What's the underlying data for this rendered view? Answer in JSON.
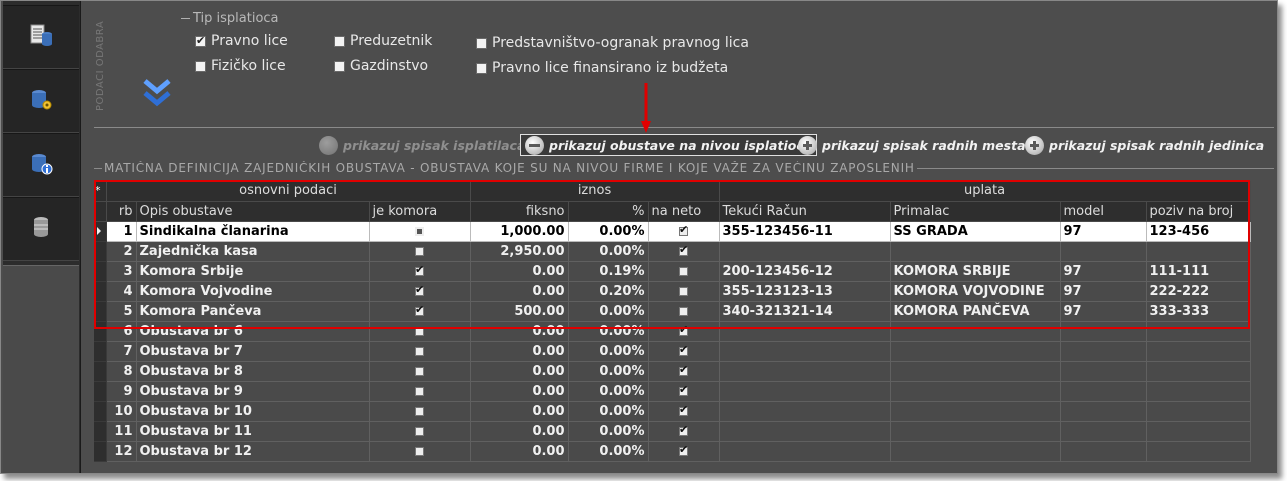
{
  "sidebar": {
    "buttons": [
      {
        "icon": "database-list-icon"
      },
      {
        "icon": "database-settings-icon"
      },
      {
        "icon": "database-info-icon"
      },
      {
        "icon": "database-icon"
      }
    ]
  },
  "filter": {
    "panel_label": "PODACI ODABRA",
    "legend": "Tip isplatioca",
    "options": [
      {
        "label": "Pravno lice",
        "checked": true
      },
      {
        "label": "Fizičko lice",
        "checked": false
      },
      {
        "label": "Preduzetnik",
        "checked": false
      },
      {
        "label": "Gazdinstvo",
        "checked": false
      },
      {
        "label": "Predstavništvo-ogranak pravnog lica",
        "checked": false
      },
      {
        "label": "Pravno lice finansirano iz budžeta",
        "checked": false
      }
    ]
  },
  "actions": {
    "isplatilaca": "prikazuj spisak isplatilaca",
    "obustave": "prikazuj obustave na nivou isplatioca",
    "radna_mesta": "prikazuj spisak radnih mesta",
    "radne_jedinice": "prikazuj spisak radnih jedinica"
  },
  "section_title": "MATIČNA DEFINICIJA ZAJEDNIČKIH OBUSTAVA - OBUSTAVA KOJE SU NA NIVOU FIRME I KOJE VAŽE ZA VEĆINU ZAPOSLENIH",
  "grid": {
    "new_row_marker": "*",
    "groups": {
      "osnovni": "osnovni podaci",
      "iznos": "iznos",
      "uplata": "uplata"
    },
    "columns": {
      "rb": "rb",
      "opis": "Opis obustave",
      "komora": "je komora",
      "fiksno": "fiksno",
      "procenat": "%",
      "neto": "na neto",
      "racun": "Tekući Račun",
      "primalac": "Primalac",
      "model": "model",
      "poziv": "poziv na broj"
    },
    "rows": [
      {
        "rb": "1",
        "opis": "Sindikalna članarina",
        "komora": "indeterminate",
        "fiksno": "1,000.00",
        "procenat": "0.00%",
        "neto": true,
        "racun": "355-123456-11",
        "primalac": "SS GRADA",
        "model": "97",
        "poziv": "123-456",
        "selected": true
      },
      {
        "rb": "2",
        "opis": "Zajednička kasa",
        "komora": false,
        "fiksno": "2,950.00",
        "procenat": "0.00%",
        "neto": true,
        "racun": "",
        "primalac": "",
        "model": "",
        "poziv": ""
      },
      {
        "rb": "3",
        "opis": "Komora Srbije",
        "komora": true,
        "fiksno": "0.00",
        "procenat": "0.19%",
        "neto": false,
        "racun": "200-123456-12",
        "primalac": "KOMORA SRBIJE",
        "model": "97",
        "poziv": "111-111"
      },
      {
        "rb": "4",
        "opis": "Komora Vojvodine",
        "komora": true,
        "fiksno": "0.00",
        "procenat": "0.20%",
        "neto": false,
        "racun": "355-123123-13",
        "primalac": "KOMORA VOJVODINE",
        "model": "97",
        "poziv": "222-222"
      },
      {
        "rb": "5",
        "opis": "Komora Pančeva",
        "komora": true,
        "fiksno": "500.00",
        "procenat": "0.00%",
        "neto": false,
        "racun": "340-321321-14",
        "primalac": "KOMORA PANČEVA",
        "model": "97",
        "poziv": "333-333"
      },
      {
        "rb": "6",
        "opis": "Obustava br 6",
        "komora": false,
        "fiksno": "0.00",
        "procenat": "0.00%",
        "neto": true,
        "racun": "",
        "primalac": "",
        "model": "",
        "poziv": ""
      },
      {
        "rb": "7",
        "opis": "Obustava br 7",
        "komora": false,
        "fiksno": "0.00",
        "procenat": "0.00%",
        "neto": true,
        "racun": "",
        "primalac": "",
        "model": "",
        "poziv": ""
      },
      {
        "rb": "8",
        "opis": "Obustava br 8",
        "komora": false,
        "fiksno": "0.00",
        "procenat": "0.00%",
        "neto": true,
        "racun": "",
        "primalac": "",
        "model": "",
        "poziv": ""
      },
      {
        "rb": "9",
        "opis": "Obustava br 9",
        "komora": false,
        "fiksno": "0.00",
        "procenat": "0.00%",
        "neto": true,
        "racun": "",
        "primalac": "",
        "model": "",
        "poziv": ""
      },
      {
        "rb": "10",
        "opis": "Obustava br 10",
        "komora": false,
        "fiksno": "0.00",
        "procenat": "0.00%",
        "neto": true,
        "racun": "",
        "primalac": "",
        "model": "",
        "poziv": ""
      },
      {
        "rb": "11",
        "opis": "Obustava br 11",
        "komora": false,
        "fiksno": "0.00",
        "procenat": "0.00%",
        "neto": true,
        "racun": "",
        "primalac": "",
        "model": "",
        "poziv": ""
      },
      {
        "rb": "12",
        "opis": "Obustava br 12",
        "komora": false,
        "fiksno": "0.00",
        "procenat": "0.00%",
        "neto": true,
        "racun": "",
        "primalac": "",
        "model": "",
        "poziv": ""
      }
    ]
  },
  "annotation": {
    "color": "#e00000"
  },
  "colors": {
    "panel": "#4d4d4d",
    "header": "#2e2e2e",
    "selected_row": "#ffffff",
    "accent_chevron": "#2f6fd6"
  }
}
